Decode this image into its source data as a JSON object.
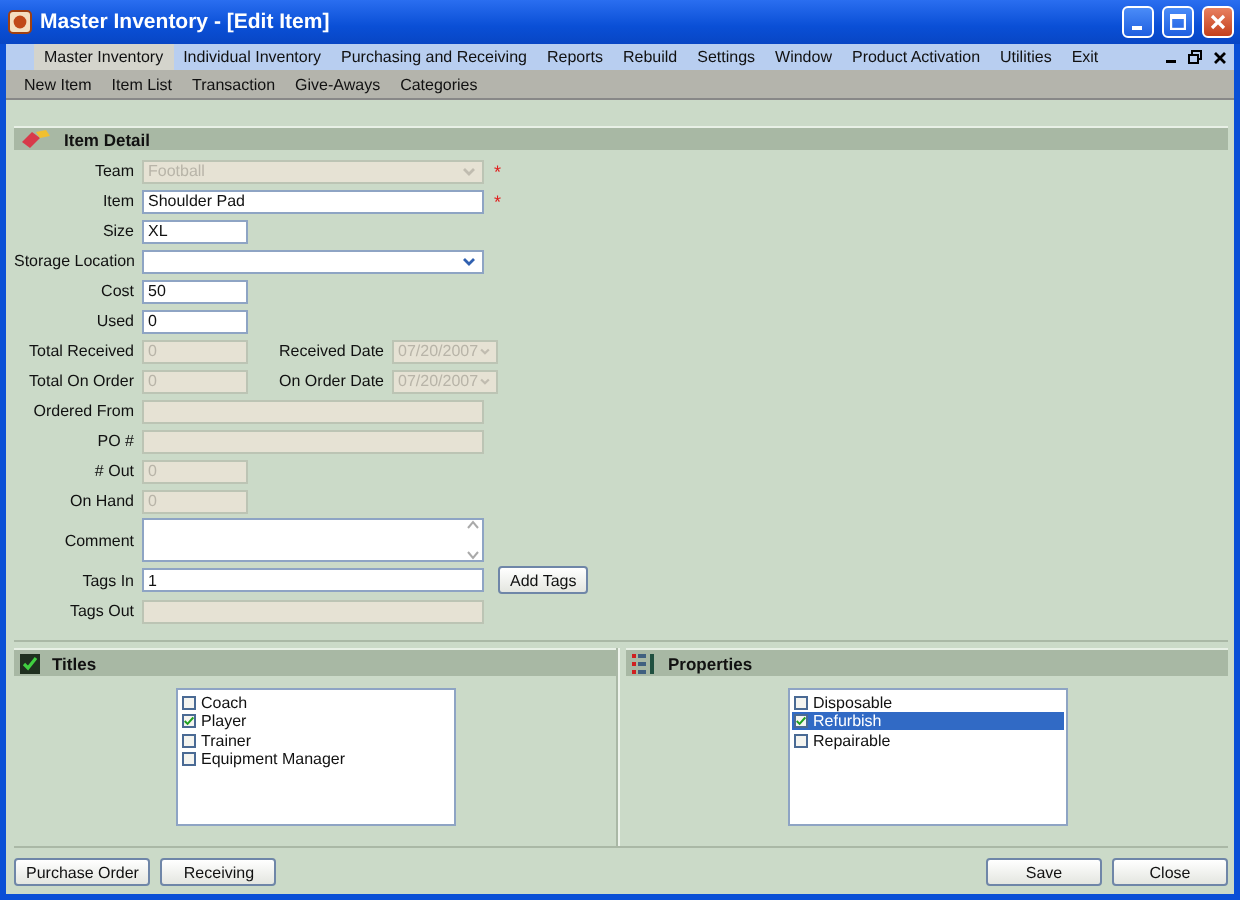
{
  "window": {
    "title": "Master Inventory - [Edit Item]"
  },
  "menu": [
    {
      "label": "Master Inventory",
      "selected": true
    },
    {
      "label": "Individual Inventory",
      "selected": false
    },
    {
      "label": "Purchasing and Receiving",
      "selected": false
    },
    {
      "label": "Reports",
      "selected": false
    },
    {
      "label": "Rebuild",
      "selected": false
    },
    {
      "label": "Settings",
      "selected": false
    },
    {
      "label": "Window",
      "selected": false
    },
    {
      "label": "Product Activation",
      "selected": false
    },
    {
      "label": "Utilities",
      "selected": false
    },
    {
      "label": "Exit",
      "selected": false
    }
  ],
  "submenu": [
    "New Item",
    "Item List",
    "Transaction",
    "Give-Aways",
    "Categories"
  ],
  "item_detail": {
    "title": "Item Detail",
    "fields": [
      {
        "label": "Team",
        "kind": "select",
        "value": "Football",
        "disabled": true,
        "marker": "*"
      },
      {
        "label": "Item",
        "kind": "text",
        "value": "Shoulder Pad",
        "disabled": false,
        "marker": "*"
      },
      {
        "label": "Size",
        "kind": "short",
        "value": "XL",
        "disabled": false
      },
      {
        "label": "Storage Location",
        "kind": "select",
        "disabled": false
      },
      {
        "label": "Cost",
        "kind": "short",
        "value": "50",
        "disabled": false
      },
      {
        "label": "Used",
        "kind": "short",
        "value": "0",
        "disabled": false
      },
      {
        "label": "Total Received",
        "kind": "short",
        "value": "0",
        "disabled": true,
        "date": {
          "label": "Received Date",
          "value": "07/20/2007",
          "disabled": true
        }
      },
      {
        "label": "Total On Order",
        "kind": "short",
        "value": "0",
        "disabled": true,
        "date": {
          "label": "On Order Date",
          "value": "07/20/2007",
          "disabled": true
        }
      },
      {
        "label": "Ordered From",
        "kind": "text",
        "disabled": true
      },
      {
        "label": "PO #",
        "kind": "text",
        "disabled": true
      },
      {
        "label": "# Out",
        "kind": "short",
        "value": "0",
        "disabled": true
      },
      {
        "label": "On Hand",
        "kind": "short",
        "value": "0",
        "disabled": true
      },
      {
        "label": "Comment",
        "kind": "textarea"
      },
      {
        "label": "Tags In",
        "kind": "text",
        "value": "1",
        "disabled": false,
        "button": "Add Tags"
      },
      {
        "label": "Tags Out",
        "kind": "text",
        "disabled": true
      }
    ]
  },
  "titles": {
    "title": "Titles",
    "items": [
      {
        "label": "Coach",
        "checked": false,
        "selected": false
      },
      {
        "label": "Player",
        "checked": true,
        "selected": false
      },
      {
        "label": "Trainer",
        "checked": false,
        "selected": false
      },
      {
        "label": "Equipment Manager",
        "checked": false,
        "selected": false
      }
    ]
  },
  "properties": {
    "title": "Properties",
    "items": [
      {
        "label": "Disposable",
        "checked": false,
        "selected": false
      },
      {
        "label": "Refurbish",
        "checked": true,
        "selected": true
      },
      {
        "label": "Repairable",
        "checked": false,
        "selected": false
      }
    ]
  },
  "buttons_left": [
    "Purchase Order",
    "Receiving"
  ],
  "buttons_right": [
    "Save",
    "Close"
  ]
}
